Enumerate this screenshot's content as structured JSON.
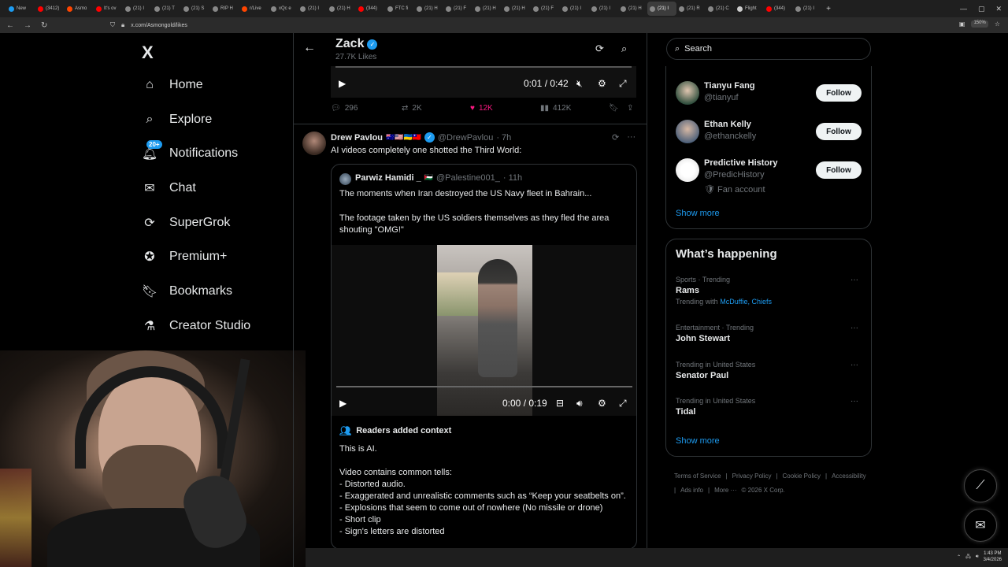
{
  "browser": {
    "tabs": [
      "New",
      "(3412)",
      "Asmo",
      "It's ov",
      "(21) I",
      "(21) T",
      "(21) S",
      "RIP H",
      "r/Live",
      "xQc e",
      "(21) I",
      "(21) H",
      "(344)",
      "FTC fi",
      "(21) H",
      "(21) F",
      "(21) H",
      "(21) H",
      "(21) F",
      "(21) I",
      "(21) I",
      "(21) H",
      "(21) I",
      "(21) R",
      "(21) C",
      "Flight",
      "(344)",
      "(21) I"
    ],
    "url": "x.com/Asmongold/likes",
    "zoom": "150%"
  },
  "nav": {
    "logo": "X",
    "items": [
      {
        "label": "Home",
        "icon": "home-icon"
      },
      {
        "label": "Explore",
        "icon": "search-icon"
      },
      {
        "label": "Notifications",
        "icon": "bell-icon",
        "badge": "20+"
      },
      {
        "label": "Chat",
        "icon": "mail-icon"
      },
      {
        "label": "SuperGrok",
        "icon": "grok-icon"
      },
      {
        "label": "Premium+",
        "icon": "verified-badge-icon"
      },
      {
        "label": "Bookmarks",
        "icon": "bookmark-icon"
      },
      {
        "label": "Creator Studio",
        "icon": "flask-icon"
      }
    ]
  },
  "header": {
    "name": "Zack",
    "likes": "27.7K Likes"
  },
  "video1": {
    "time": "0:01 / 0:42"
  },
  "post_actions": {
    "replies": "296",
    "reposts": "2K",
    "likes": "12K",
    "views": "412K"
  },
  "tweet": {
    "name": "Drew Pavlou",
    "flags": "🇦🇺🇺🇸🇺🇦🇹🇼",
    "handle": "@DrewPavlou",
    "time": "· 7h",
    "text": "AI videos completely one shotted the Third World:"
  },
  "quote": {
    "name": "Parwiz Hamidi _",
    "flag": "🇵🇸",
    "handle": "@Palestine001_",
    "time": "· 11h",
    "text1": "The moments when Iran destroyed the US Navy fleet in Bahrain...",
    "text2": "The footage taken by the US soldiers themselves as they fled the area shouting \"OMG!\"",
    "video_time": "0:00 / 0:19"
  },
  "context": {
    "title": "Readers added context",
    "body": "This is AI.\n\nVideo contains common tells:\n- Distorted audio.\n- Exaggerated and unrealistic comments such as “Keep your seatbelts on”.\n- Explosions that seem to come out of nowhere (No missile or drone)\n- Short clip\n- Sign's letters are distorted"
  },
  "search": {
    "placeholder": "Search"
  },
  "who_to_follow": [
    {
      "name": "Tianyu Fang",
      "handle": "@tianyuf",
      "button": "Follow"
    },
    {
      "name": "Ethan Kelly",
      "handle": "@ethanckelly",
      "button": "Follow"
    },
    {
      "name": "Predictive History",
      "handle": "@PredicHistory",
      "extra": "🛡 Fan account",
      "button": "Follow"
    }
  ],
  "show_more": "Show more",
  "whats_happening": {
    "title": "What’s happening",
    "trends": [
      {
        "category": "Sports · Trending",
        "title": "Rams",
        "with_prefix": "Trending with ",
        "with_links": "McDuffie, Chiefs"
      },
      {
        "category": "Entertainment · Trending",
        "title": "John Stewart"
      },
      {
        "category": "Trending in United States",
        "title": "Senator Paul"
      },
      {
        "category": "Trending in United States",
        "title": "Tidal"
      }
    ],
    "show_more": "Show more"
  },
  "footer": {
    "links": [
      "Terms of Service",
      "|",
      "Privacy Policy",
      "|",
      "Cookie Policy",
      "|",
      "Accessibility",
      "|",
      "Ads info",
      "|",
      "More ···",
      "© 2026 X Corp."
    ]
  },
  "taskbar": {
    "time": "1:43 PM",
    "date": "3/4/2026"
  },
  "colors": {
    "accent": "#1d9bf0",
    "like": "#f91880",
    "background": "#000000"
  }
}
